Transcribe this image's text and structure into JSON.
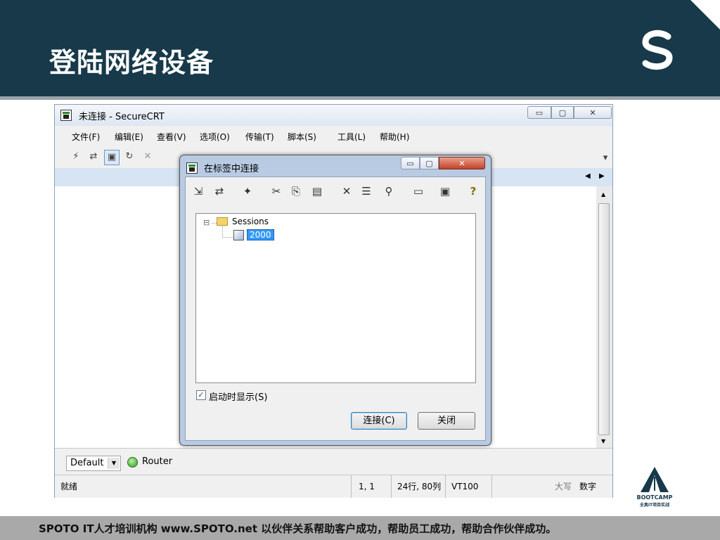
{
  "slide": {
    "title": "登陆网络设备",
    "footer": "SPOTO IT人才培训机构   www.SPOTO.net   以伙伴关系帮助客户成功，帮助员工成功，帮助合作伙伴成功。",
    "bootcamp_line1": "BOOTCAMP",
    "bootcamp_line2": "全真IT项目实战",
    "colors": {
      "header": "#17394a",
      "footer": "#a9a9a9",
      "accent": "#9aa3a8"
    }
  },
  "app": {
    "window_title": "未连接 - SecureCRT",
    "caption_buttons": {
      "minimize": "▭",
      "maximize": "▢",
      "close": "✕"
    },
    "menu": [
      "文件(F)",
      "编辑(E)",
      "查看(V)",
      "选项(O)",
      "传输(T)",
      "脚本(S)",
      "工具(L)",
      "帮助(H)"
    ],
    "tab_arrows": {
      "left": "◀",
      "right": "▶"
    },
    "session_select": "Default",
    "router_label": "Router",
    "status": {
      "ready": "就绪",
      "position": "1,  1",
      "size": "24行, 80列",
      "terminal": "VT100",
      "caps": "大写",
      "num": "数字"
    }
  },
  "dialog": {
    "title": "在标签中连接",
    "tree": {
      "root": "Sessions",
      "child": "2000",
      "expander": "⊟"
    },
    "checkbox_label": "启动时显示(S)",
    "checkbox_mark": "✓",
    "connect_button": "连接(C)",
    "close_button": "关闭"
  }
}
